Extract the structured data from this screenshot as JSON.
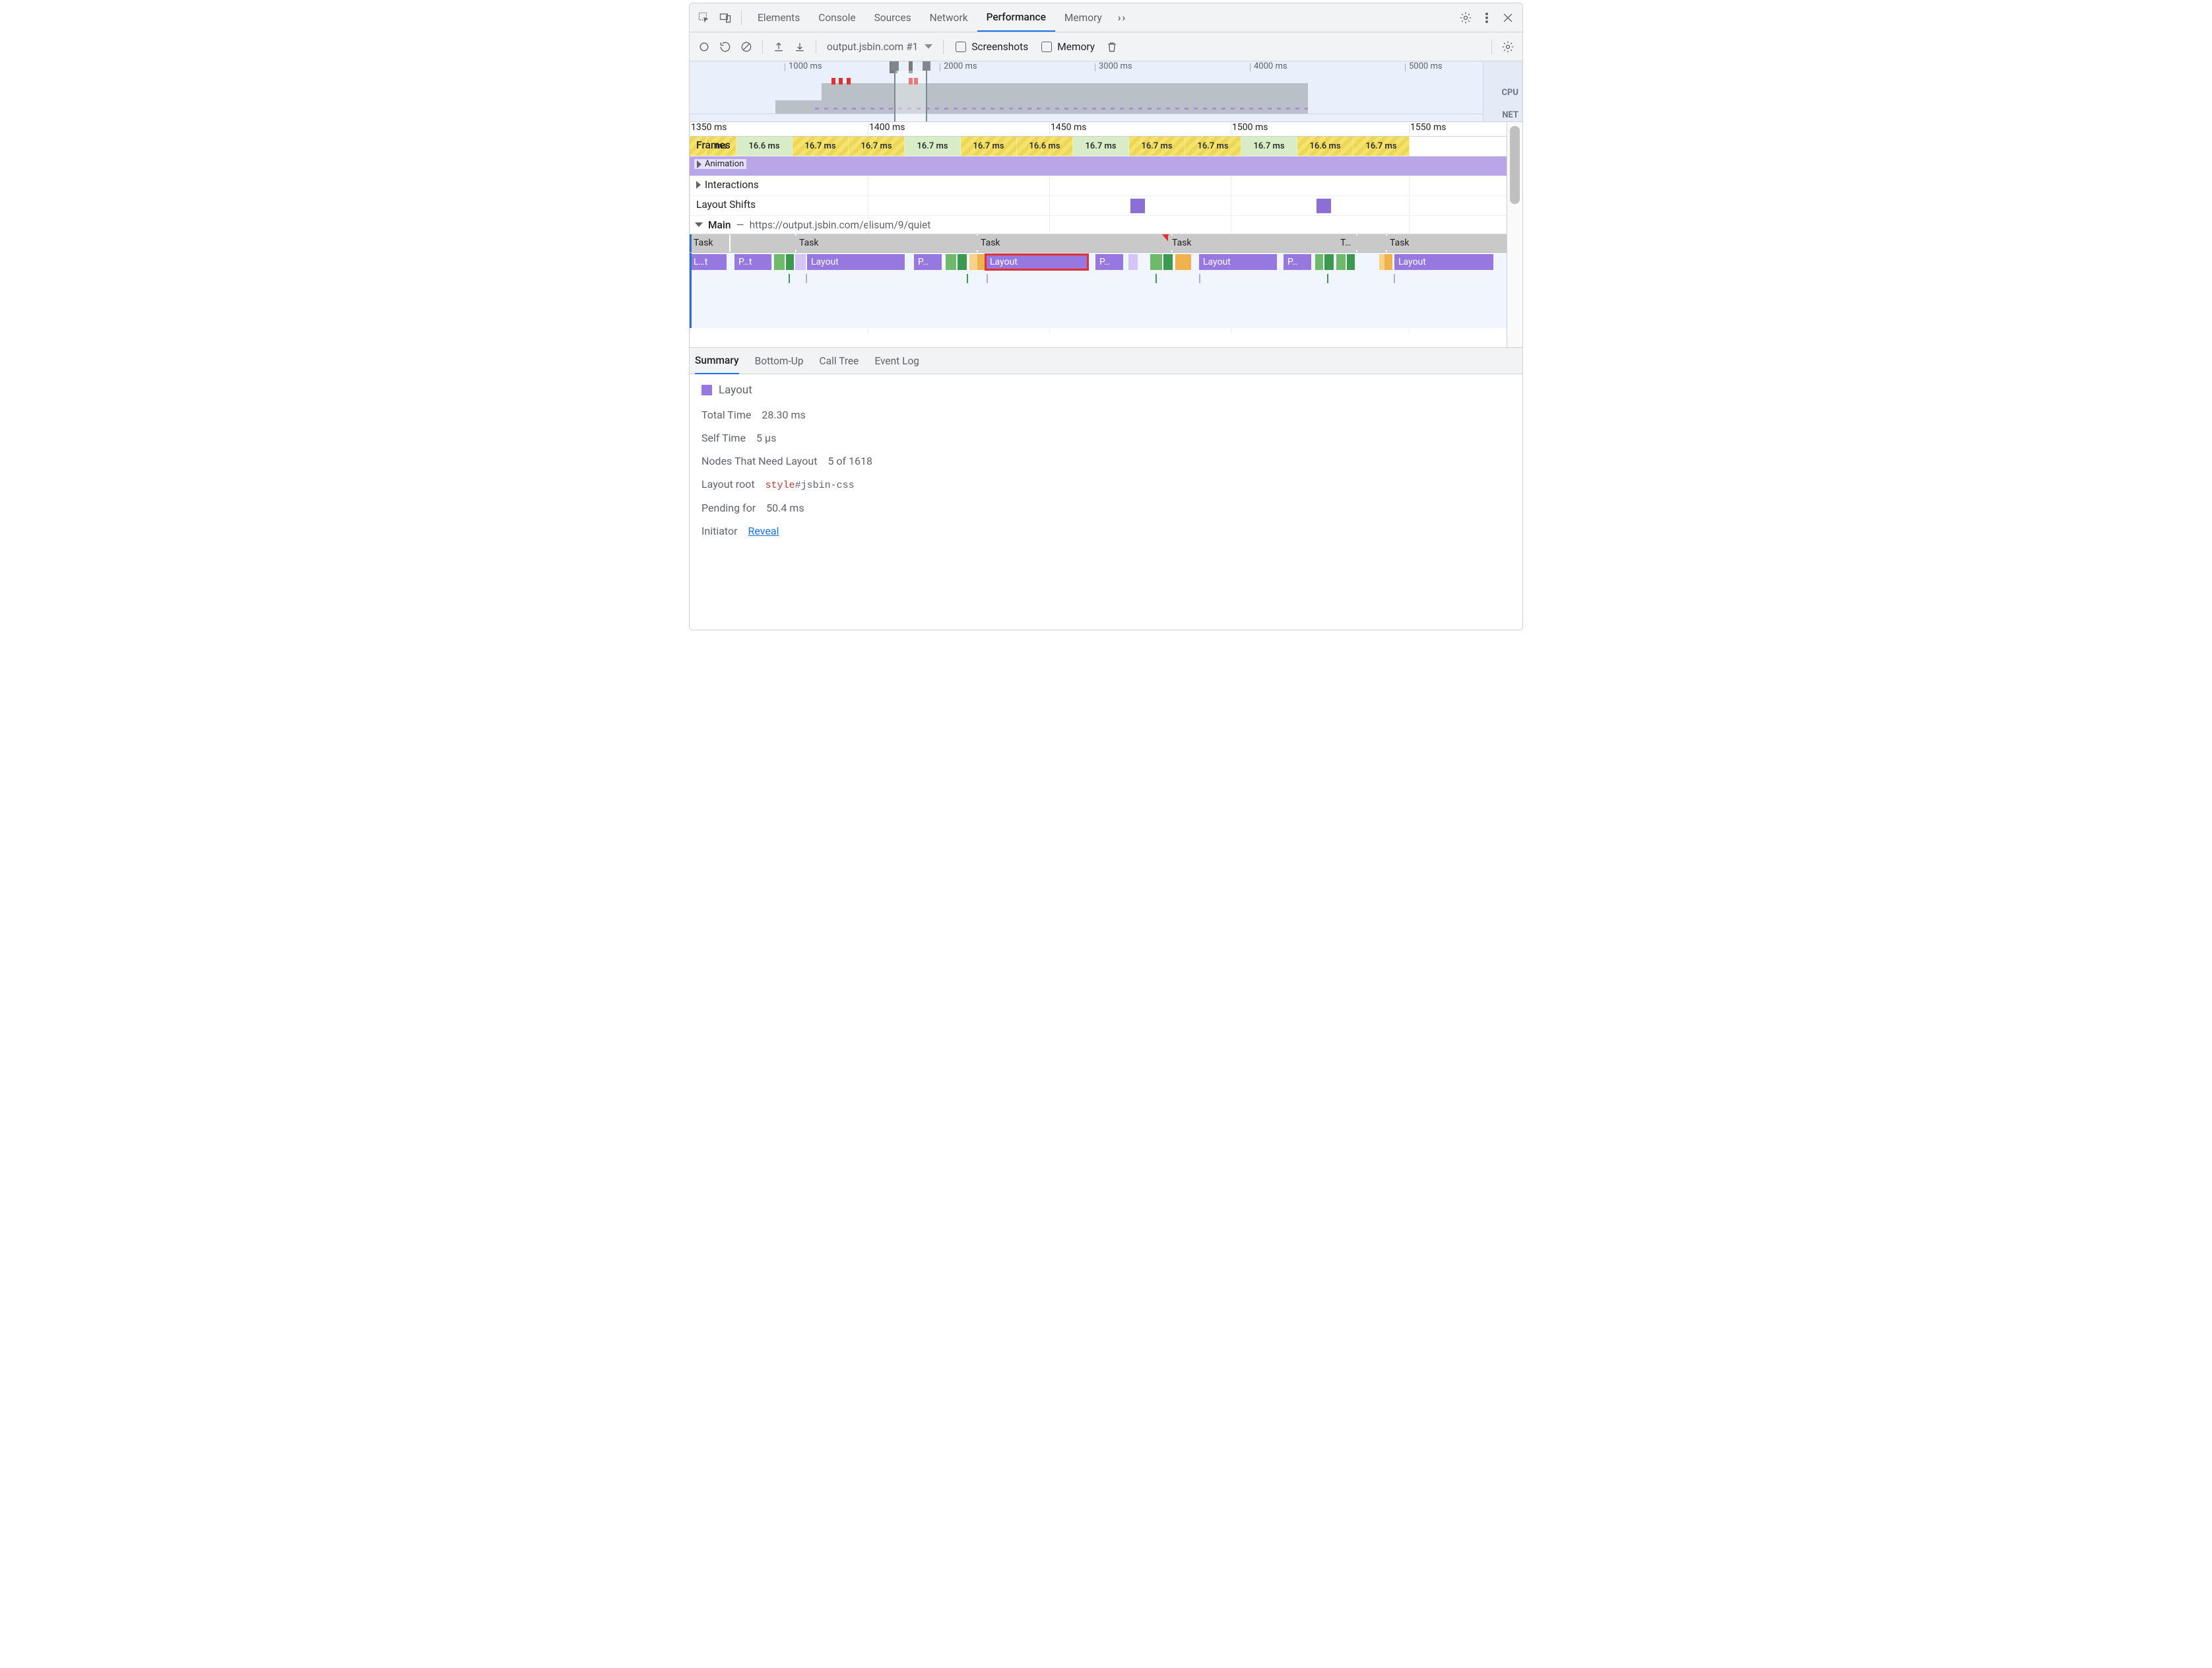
{
  "tabs": [
    "Elements",
    "Console",
    "Sources",
    "Network",
    "Performance",
    "Memory"
  ],
  "active_tab": "Performance",
  "toolbar": {
    "dropdown": "output.jsbin.com #1",
    "screenshots_label": "Screenshots",
    "memory_label": "Memory"
  },
  "overview": {
    "ticks": [
      "1000 ms",
      "2000 ms",
      "3000 ms",
      "4000 ms",
      "5000 ms"
    ],
    "right_labels": {
      "cpu": "CPU",
      "net": "NET"
    }
  },
  "ruler_ticks": [
    "1350 ms",
    "1400 ms",
    "1450 ms",
    "1500 ms",
    "1550 ms"
  ],
  "tracks": {
    "frames": {
      "label": "Frames",
      "cells": [
        {
          "t": "",
          "c": "y",
          "w": 26
        },
        {
          "t": "ms",
          "c": "y",
          "w": 45
        },
        {
          "t": "16.6 ms",
          "c": "g",
          "w": 85
        },
        {
          "t": "16.7 ms",
          "c": "y",
          "w": 85
        },
        {
          "t": "16.7 ms",
          "c": "y",
          "w": 85
        },
        {
          "t": "16.7 ms",
          "c": "g",
          "w": 85
        },
        {
          "t": "16.7 ms",
          "c": "y",
          "w": 85
        },
        {
          "t": "16.6 ms",
          "c": "y",
          "w": 85
        },
        {
          "t": "16.7 ms",
          "c": "g",
          "w": 85
        },
        {
          "t": "16.7 ms",
          "c": "y",
          "w": 85
        },
        {
          "t": "16.7 ms",
          "c": "y",
          "w": 85
        },
        {
          "t": "16.7 ms",
          "c": "g",
          "w": 85
        },
        {
          "t": "16.6 ms",
          "c": "y",
          "w": 85
        },
        {
          "t": "16.7 ms",
          "c": "y",
          "w": 85
        }
      ]
    },
    "animation_label": "Animation",
    "interactions_label": "Interactions",
    "layout_shifts_label": "Layout Shifts",
    "main_label": "Main",
    "main_sep": "—",
    "main_url": "https://output.jsbin.com/elisum/9/quiet"
  },
  "tasks": {
    "label": "Task",
    "cells": [
      {
        "l": 0,
        "w": 60,
        "t": "Task"
      },
      {
        "l": 160,
        "w": 170,
        "t": "Task"
      },
      {
        "l": 435,
        "w": 150,
        "t": "Task"
      },
      {
        "l": 725,
        "w": 180,
        "t": "Task"
      },
      {
        "l": 980,
        "w": 55,
        "t": "T…"
      },
      {
        "l": 1055,
        "w": 170,
        "t": "Task"
      }
    ],
    "dividers": [
      60,
      160,
      435,
      730,
      1010,
      1055
    ]
  },
  "calls": [
    {
      "l": 0,
      "w": 56,
      "c": "purple",
      "t": "L…t"
    },
    {
      "l": 68,
      "w": 56,
      "c": "purple",
      "t": "P…t"
    },
    {
      "l": 128,
      "w": 16,
      "c": "green",
      "t": ""
    },
    {
      "l": 146,
      "w": 12,
      "c": "emer",
      "t": ""
    },
    {
      "l": 160,
      "w": 16,
      "c": "pale",
      "t": ""
    },
    {
      "l": 178,
      "w": 148,
      "c": "purple",
      "t": "Layout"
    },
    {
      "l": 340,
      "w": 42,
      "c": "purple",
      "t": "P…"
    },
    {
      "l": 388,
      "w": 16,
      "c": "green",
      "t": ""
    },
    {
      "l": 406,
      "w": 14,
      "c": "emer",
      "t": ""
    },
    {
      "l": 424,
      "w": 10,
      "c": "orange-lt",
      "t": ""
    },
    {
      "l": 436,
      "w": 10,
      "c": "orange",
      "t": ""
    },
    {
      "l": 449,
      "w": 154,
      "c": "purple",
      "t": "Layout",
      "hl": true
    },
    {
      "l": 615,
      "w": 42,
      "c": "purple",
      "t": "P…"
    },
    {
      "l": 665,
      "w": 14,
      "c": "pale",
      "t": ""
    },
    {
      "l": 698,
      "w": 18,
      "c": "green",
      "t": ""
    },
    {
      "l": 718,
      "w": 14,
      "c": "emer",
      "t": ""
    },
    {
      "l": 736,
      "w": 24,
      "c": "orange",
      "t": ""
    },
    {
      "l": 772,
      "w": 118,
      "c": "purple",
      "t": "Layout"
    },
    {
      "l": 900,
      "w": 42,
      "c": "purple",
      "t": "P…"
    },
    {
      "l": 948,
      "w": 12,
      "c": "green",
      "t": ""
    },
    {
      "l": 962,
      "w": 14,
      "c": "emer",
      "t": ""
    },
    {
      "l": 980,
      "w": 14,
      "c": "green",
      "t": ""
    },
    {
      "l": 996,
      "w": 10,
      "c": "emer",
      "t": ""
    },
    {
      "l": 1045,
      "w": 6,
      "c": "orange-lt",
      "t": ""
    },
    {
      "l": 1053,
      "w": 8,
      "c": "orange",
      "t": ""
    },
    {
      "l": 1068,
      "w": 150,
      "c": "purple",
      "t": "Layout"
    }
  ],
  "subticks": [
    {
      "l": 150,
      "c": "#3c9a4f"
    },
    {
      "l": 176,
      "c": "#b9a6e9"
    },
    {
      "l": 420,
      "c": "#3c9a4f"
    },
    {
      "l": 450,
      "c": "#b9a6e9"
    },
    {
      "l": 706,
      "c": "#3c9a4f"
    },
    {
      "l": 772,
      "c": "#b9a6e9"
    },
    {
      "l": 966,
      "c": "#3c9a4f"
    },
    {
      "l": 1067,
      "c": "#b9a6e9"
    }
  ],
  "bottom_tabs": [
    "Summary",
    "Bottom-Up",
    "Call Tree",
    "Event Log"
  ],
  "active_bottom_tab": "Summary",
  "summary": {
    "title": "Layout",
    "rows": [
      {
        "k": "Total Time",
        "v": "28.30 ms"
      },
      {
        "k": "Self Time",
        "v": "5 µs"
      },
      {
        "k": "Nodes That Need Layout",
        "v": "5 of 1618"
      }
    ],
    "layout_root_k": "Layout root",
    "layout_root_tag": "style",
    "layout_root_sel": "#jsbin-css",
    "pending_k": "Pending for",
    "pending_v": "50.4 ms",
    "initiator_k": "Initiator",
    "initiator_link": "Reveal"
  }
}
